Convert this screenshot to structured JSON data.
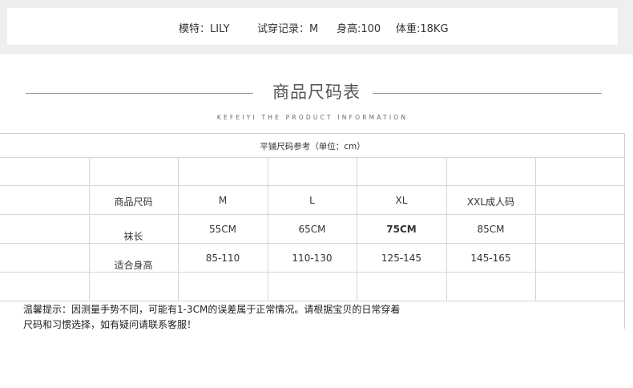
{
  "model_info": {
    "model": "模特：LILY",
    "record": "试穿记录：M",
    "height": "身高:100",
    "weight": "体重:18KG"
  },
  "section": {
    "title": "商品尺码表",
    "subtitle": "KEFEIYI THE PRODUCT INFORMATION"
  },
  "table": {
    "caption": "平铺尺码参考（单位：cm）",
    "header": [
      "商品尺码",
      "M",
      "L",
      "XL",
      "XXL成人码"
    ],
    "rows": [
      [
        "袜长",
        "55CM",
        "65CM",
        "75CM",
        "85CM"
      ],
      [
        "适合身高",
        "85-110",
        "110-130",
        "125-145",
        "145-165"
      ]
    ]
  },
  "note": {
    "line1": "温馨提示：因测量手势不同，可能有1-3CM的误差属于正常情况。请根据宝贝的日常穿着",
    "line2": "尺码和习惯选择，如有疑问请联系客服！"
  }
}
